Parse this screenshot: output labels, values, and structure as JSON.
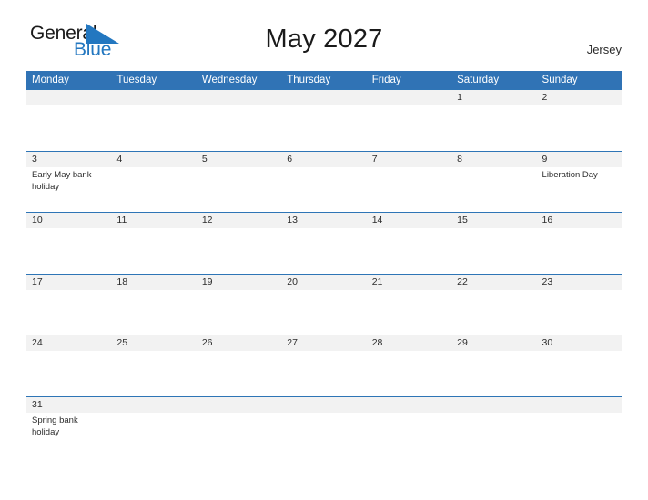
{
  "brand": {
    "word_one": "General",
    "word_two": "Blue",
    "flag_icon": "blue-triangle-flag-icon",
    "black_hex": "#1a1a1a",
    "blue_hex": "#2377c0"
  },
  "header": {
    "title": "May 2027",
    "region": "Jersey"
  },
  "calendar": {
    "accent_hex": "#3073b5",
    "band_hex": "#f2f2f2",
    "rule_hex": "#2e75b6",
    "weekday_headers": [
      "Monday",
      "Tuesday",
      "Wednesday",
      "Thursday",
      "Friday",
      "Saturday",
      "Sunday"
    ],
    "weeks": [
      [
        {
          "day": "",
          "event": ""
        },
        {
          "day": "",
          "event": ""
        },
        {
          "day": "",
          "event": ""
        },
        {
          "day": "",
          "event": ""
        },
        {
          "day": "",
          "event": ""
        },
        {
          "day": "1",
          "event": ""
        },
        {
          "day": "2",
          "event": ""
        }
      ],
      [
        {
          "day": "3",
          "event": "Early May bank holiday"
        },
        {
          "day": "4",
          "event": ""
        },
        {
          "day": "5",
          "event": ""
        },
        {
          "day": "6",
          "event": ""
        },
        {
          "day": "7",
          "event": ""
        },
        {
          "day": "8",
          "event": ""
        },
        {
          "day": "9",
          "event": "Liberation Day"
        }
      ],
      [
        {
          "day": "10",
          "event": ""
        },
        {
          "day": "11",
          "event": ""
        },
        {
          "day": "12",
          "event": ""
        },
        {
          "day": "13",
          "event": ""
        },
        {
          "day": "14",
          "event": ""
        },
        {
          "day": "15",
          "event": ""
        },
        {
          "day": "16",
          "event": ""
        }
      ],
      [
        {
          "day": "17",
          "event": ""
        },
        {
          "day": "18",
          "event": ""
        },
        {
          "day": "19",
          "event": ""
        },
        {
          "day": "20",
          "event": ""
        },
        {
          "day": "21",
          "event": ""
        },
        {
          "day": "22",
          "event": ""
        },
        {
          "day": "23",
          "event": ""
        }
      ],
      [
        {
          "day": "24",
          "event": ""
        },
        {
          "day": "25",
          "event": ""
        },
        {
          "day": "26",
          "event": ""
        },
        {
          "day": "27",
          "event": ""
        },
        {
          "day": "28",
          "event": ""
        },
        {
          "day": "29",
          "event": ""
        },
        {
          "day": "30",
          "event": ""
        }
      ],
      [
        {
          "day": "31",
          "event": "Spring bank holiday"
        },
        {
          "day": "",
          "event": ""
        },
        {
          "day": "",
          "event": ""
        },
        {
          "day": "",
          "event": ""
        },
        {
          "day": "",
          "event": ""
        },
        {
          "day": "",
          "event": ""
        },
        {
          "day": "",
          "event": ""
        }
      ]
    ]
  }
}
